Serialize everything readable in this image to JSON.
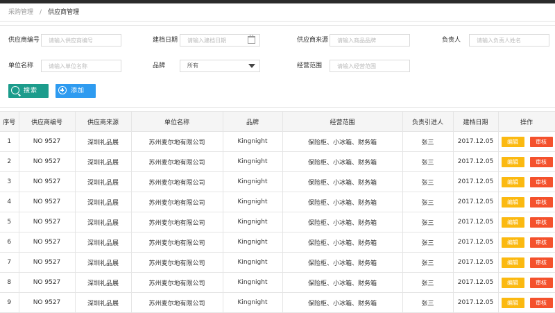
{
  "breadcrumb": {
    "root": "采购管理",
    "separator": "/",
    "current": "供应商管理"
  },
  "filters": {
    "supplier_no": {
      "label": "供应商编号",
      "placeholder": "请输入供应商编号"
    },
    "created_date": {
      "label": "建档日期",
      "placeholder": "请输入建档日期"
    },
    "source": {
      "label": "供应商来源",
      "placeholder": "请输入商品品牌"
    },
    "owner": {
      "label": "负责人",
      "placeholder": "请输入负责人姓名"
    },
    "company": {
      "label": "单位名称",
      "placeholder": "请输入单位名称"
    },
    "brand": {
      "label": "品牌",
      "selected": "所有"
    },
    "scope": {
      "label": "经营范围",
      "placeholder": "请输入经营范围"
    }
  },
  "buttons": {
    "search": "搜索",
    "add": "添加"
  },
  "table": {
    "headers": [
      "序号",
      "供应商编号",
      "供应商来源",
      "单位名称",
      "品牌",
      "经营范围",
      "负责引进人",
      "建档日期",
      "操作"
    ],
    "edit_label": "编辑",
    "audit_label": "审核",
    "rows": [
      {
        "index": "1",
        "no": "NO 9527",
        "source": "深圳礼品展",
        "company": "苏州麦尔地有限公司",
        "brand": "Kingnight",
        "scope": "保险柜、小冰箱、财务箱",
        "person": "张三",
        "date": "2017.12.05"
      },
      {
        "index": "2",
        "no": "NO 9527",
        "source": "深圳礼品展",
        "company": "苏州麦尔地有限公司",
        "brand": "Kingnight",
        "scope": "保险柜、小冰箱、财务箱",
        "person": "张三",
        "date": "2017.12.05"
      },
      {
        "index": "3",
        "no": "NO 9527",
        "source": "深圳礼品展",
        "company": "苏州麦尔地有限公司",
        "brand": "Kingnight",
        "scope": "保险柜、小冰箱、财务箱",
        "person": "张三",
        "date": "2017.12.05"
      },
      {
        "index": "4",
        "no": "NO 9527",
        "source": "深圳礼品展",
        "company": "苏州麦尔地有限公司",
        "brand": "Kingnight",
        "scope": "保险柜、小冰箱、财务箱",
        "person": "张三",
        "date": "2017.12.05"
      },
      {
        "index": "5",
        "no": "NO 9527",
        "source": "深圳礼品展",
        "company": "苏州麦尔地有限公司",
        "brand": "Kingnight",
        "scope": "保险柜、小冰箱、财务箱",
        "person": "张三",
        "date": "2017.12.05"
      },
      {
        "index": "6",
        "no": "NO 9527",
        "source": "深圳礼品展",
        "company": "苏州麦尔地有限公司",
        "brand": "Kingnight",
        "scope": "保险柜、小冰箱、财务箱",
        "person": "张三",
        "date": "2017.12.05"
      },
      {
        "index": "7",
        "no": "NO 9527",
        "source": "深圳礼品展",
        "company": "苏州麦尔地有限公司",
        "brand": "Kingnight",
        "scope": "保险柜、小冰箱、财务箱",
        "person": "张三",
        "date": "2017.12.05"
      },
      {
        "index": "8",
        "no": "NO 9527",
        "source": "深圳礼品展",
        "company": "苏州麦尔地有限公司",
        "brand": "Kingnight",
        "scope": "保险柜、小冰箱、财务箱",
        "person": "张三",
        "date": "2017.12.05"
      },
      {
        "index": "9",
        "no": "NO 9527",
        "source": "深圳礼品展",
        "company": "苏州麦尔地有限公司",
        "brand": "Kingnight",
        "scope": "保险柜、小冰箱、财务箱",
        "person": "张三",
        "date": "2017.12.05"
      }
    ]
  },
  "colors": {
    "search_button": "#1c9c8c",
    "add_button": "#2e9bf0",
    "edit_button": "#fbb911",
    "audit_button": "#f4512c"
  }
}
